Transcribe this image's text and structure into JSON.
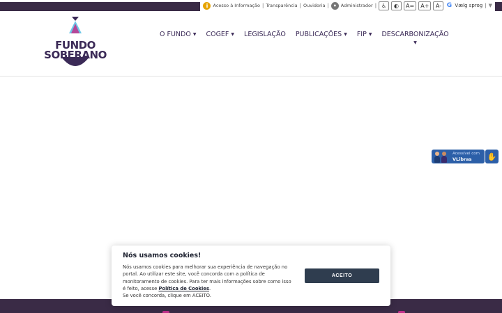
{
  "utility_bar": {
    "acesso_informacao": "Acesso à Informação",
    "transparencia": "Transparência",
    "ouvidoria": "Ouvidoria",
    "administrador": "Administrador",
    "separator": "|",
    "contrast_label": "◐",
    "font_normal": "A=",
    "font_increase": "A+",
    "font_decrease": "A-",
    "language_label": "Vælg sprog",
    "language_arrow": "▼",
    "info_icon_glyph": "i",
    "admin_icon_glyph": "•",
    "accessibility_icon_glyph": "♿",
    "google_icon_glyph": "G"
  },
  "logo": {
    "line1": "FUNDO",
    "line2": "SOBERANO"
  },
  "nav": {
    "items": [
      {
        "label": "O FUNDO",
        "caret": "▼"
      },
      {
        "label": "COGEF",
        "caret": "▼"
      },
      {
        "label": "LEGISLAÇÃO",
        "caret": ""
      },
      {
        "label": "PUBLICAÇÕES",
        "caret": "▼"
      },
      {
        "label": "FIP",
        "caret": "▼"
      },
      {
        "label": "DESCARBONIZAÇÃO",
        "caret": "▼"
      }
    ]
  },
  "vlibras": {
    "small_text": "Acessível com",
    "brand": "VLibras",
    "hand_glyph": "✋"
  },
  "cookie_banner": {
    "title": "Nós usamos cookies!",
    "text_part1": "Nós usamos cookies para melhorar sua experiência de navegação no portal. Ao utilizar este site, você concorda com a política de monitoramento de cookies. Para ter mais informações sobre como isso é feito, acesse ",
    "link_text": "Política de Cookies",
    "text_part2": ".",
    "text_part3": "Se você concorda, clique em ACEITO.",
    "accept_button": "ACEITO"
  },
  "colors": {
    "brand_dark": "#3a2b46",
    "brand_purple": "#3b2a57",
    "accent_pink": "#c0308a",
    "logo_blue": "#6ec8e8",
    "vlibras_blue": "#2c5fa8",
    "button_dark": "#2f3d4f"
  }
}
